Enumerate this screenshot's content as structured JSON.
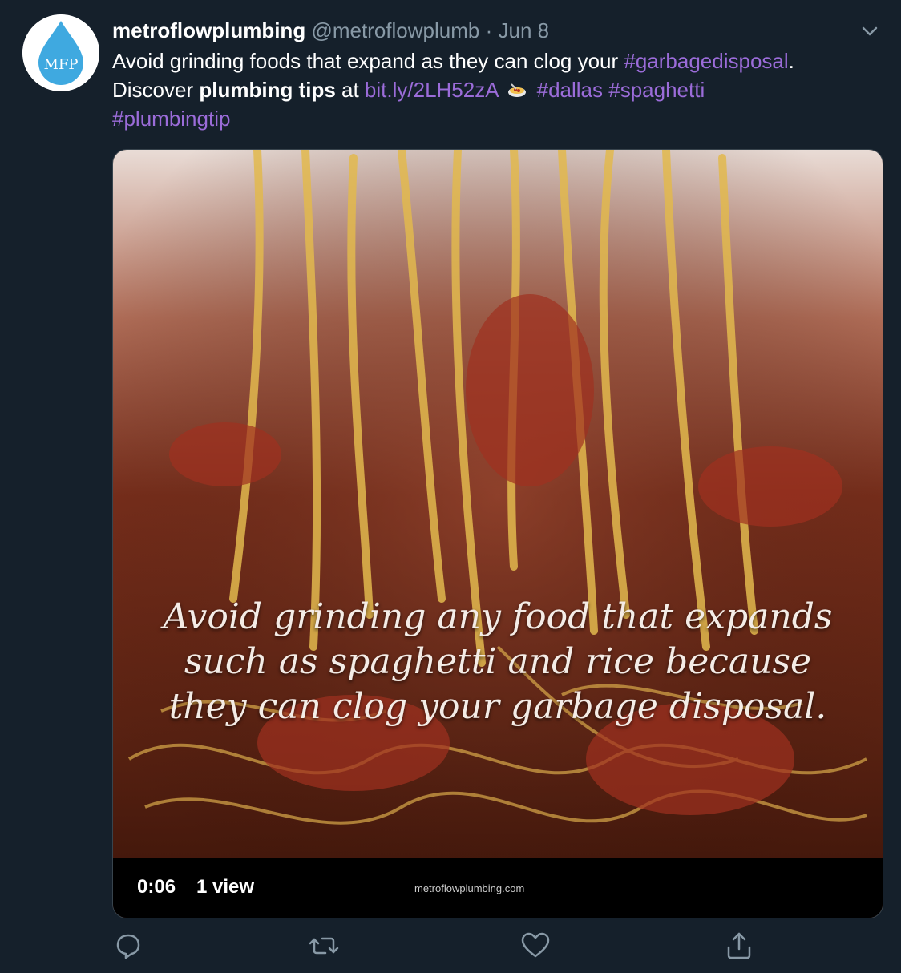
{
  "tweet": {
    "display_name": "metroflowplumbing",
    "handle": "@metroflowplumb",
    "separator": "·",
    "date": "Jun 8",
    "avatar_text": "MFP",
    "text": {
      "p1": "Avoid grinding foods that expand as they can clog your ",
      "hashtag_garbage": "#garbagedisposal",
      "p2": ".",
      "p3": "Discover ",
      "bold": "plumbing tips",
      "p4": " at ",
      "link": "bit.ly/2LH52zA",
      "hashtag_dallas": "#dallas",
      "hashtag_spaghetti": "#spaghetti",
      "hashtag_tip": "#plumbingtip"
    },
    "emoji": "spaghetti-icon"
  },
  "video": {
    "overlay_text": "Avoid grinding any food that expands such as spaghetti and rice because they can clog your garbage disposal.",
    "time": "0:06",
    "views": "1 view",
    "watermark": "metroflowplumbing.com"
  },
  "actions": {
    "reply_icon": "reply-icon",
    "retweet_icon": "retweet-icon",
    "like_icon": "heart-icon",
    "share_icon": "share-icon"
  },
  "colors": {
    "background": "#15202b",
    "link": "#9b6cd9",
    "secondary_text": "#8899a6",
    "avatar_drop": "#3fa9e0"
  }
}
